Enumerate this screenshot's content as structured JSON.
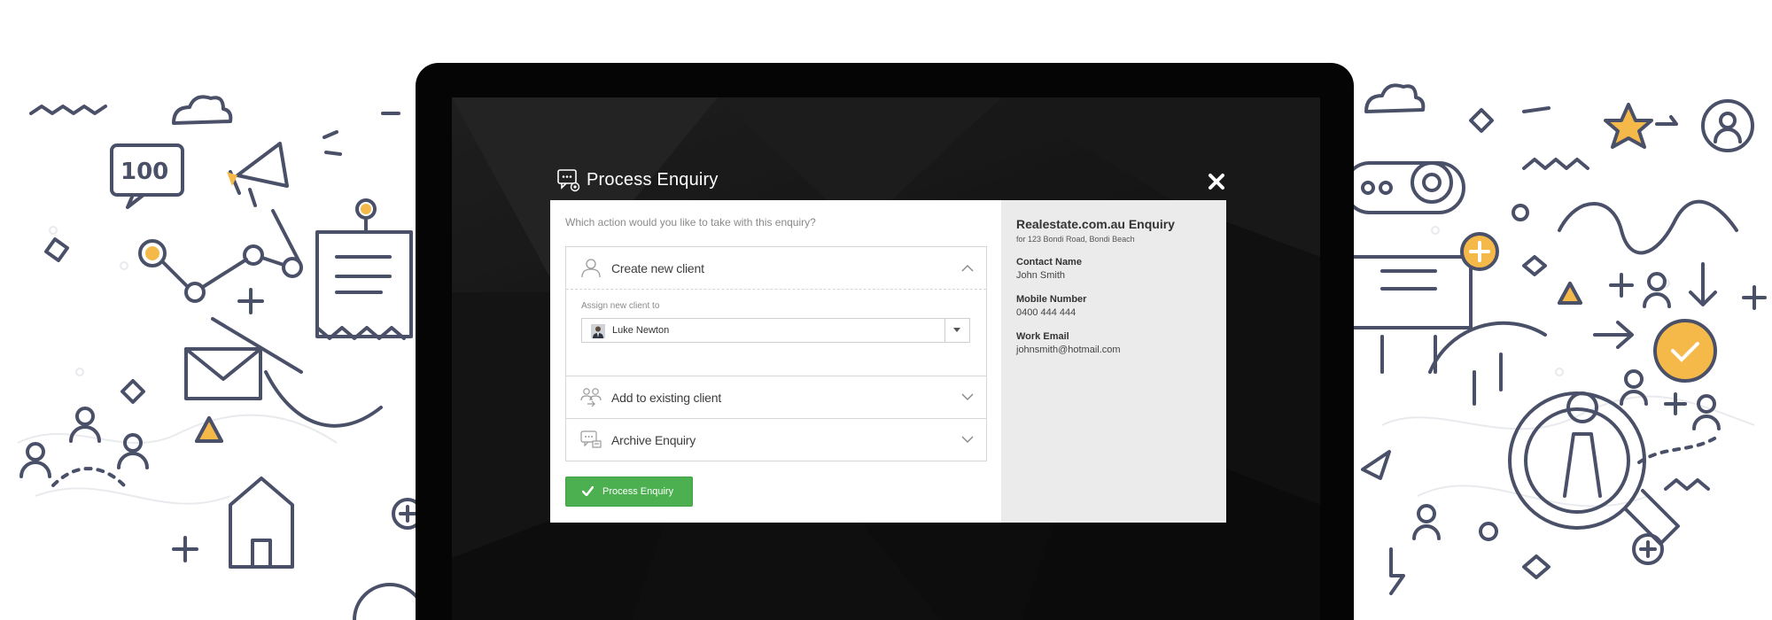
{
  "modal": {
    "title": "Process Enquiry",
    "question": "Which action would you like to take with this enquiry?",
    "sections": [
      {
        "label": "Create new client",
        "expanded": true,
        "icon": "user-icon"
      },
      {
        "label": "Add to existing client",
        "expanded": false,
        "icon": "users-icon"
      },
      {
        "label": "Archive Enquiry",
        "expanded": false,
        "icon": "archive-chat-icon"
      }
    ],
    "assign": {
      "label": "Assign new client to",
      "value": "Luke Newton"
    },
    "submit_label": "Process Enquiry"
  },
  "enquiry": {
    "title": "Realestate.com.au Enquiry",
    "subtitle": "for 123 Bondi Road, Bondi Beach",
    "fields": [
      {
        "label": "Contact Name",
        "value": "John Smith"
      },
      {
        "label": "Mobile Number",
        "value": "0400 444 444"
      },
      {
        "label": "Work Email",
        "value": "johnsmith@hotmail.com"
      }
    ]
  },
  "colors": {
    "accent_green": "#4caf50",
    "doodle_navy": "#4a5068",
    "doodle_orange": "#f5b94a",
    "panel_grey": "#ebebeb"
  }
}
